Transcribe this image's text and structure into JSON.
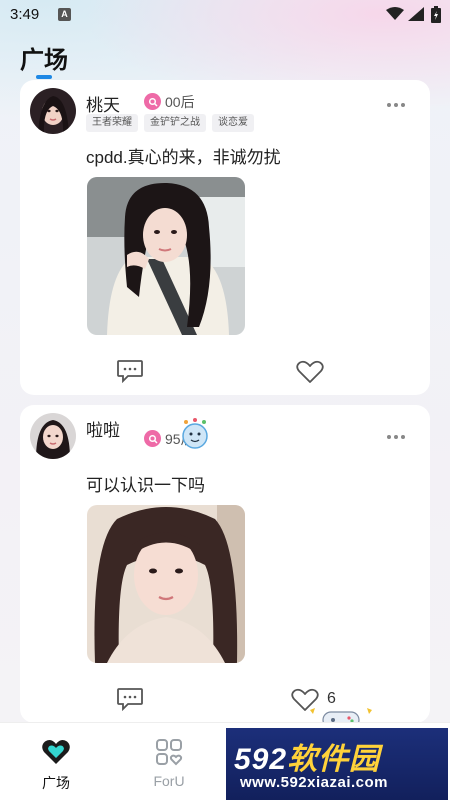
{
  "status_bar": {
    "time": "3:49",
    "notification_letter": "A"
  },
  "header": {
    "title": "广场"
  },
  "posts": [
    {
      "username": "桃天",
      "age": "00后",
      "tags": [
        "王者荣耀",
        "金铲铲之战",
        "谈恋爱"
      ],
      "text": "cpdd.真心的来，非诚勿扰",
      "like_count": ""
    },
    {
      "username": "啦啦",
      "age": "95后",
      "tags": [],
      "text": "可以认识一下吗",
      "like_count": "6"
    }
  ],
  "bottom_nav": {
    "items": [
      {
        "label": "广场",
        "icon": "heart-chat-icon",
        "active": true
      },
      {
        "label": "ForU",
        "icon": "grid-heart-icon",
        "active": false
      }
    ]
  },
  "watermark": {
    "logo_num": "592",
    "logo_cn": "软件园",
    "url": "www.592xiazai.com"
  },
  "colors": {
    "accent": "#1e88e5",
    "gender_badge": "#ee6aa7",
    "nav_active": "#111111",
    "nav_inactive": "#9aa0a6"
  }
}
